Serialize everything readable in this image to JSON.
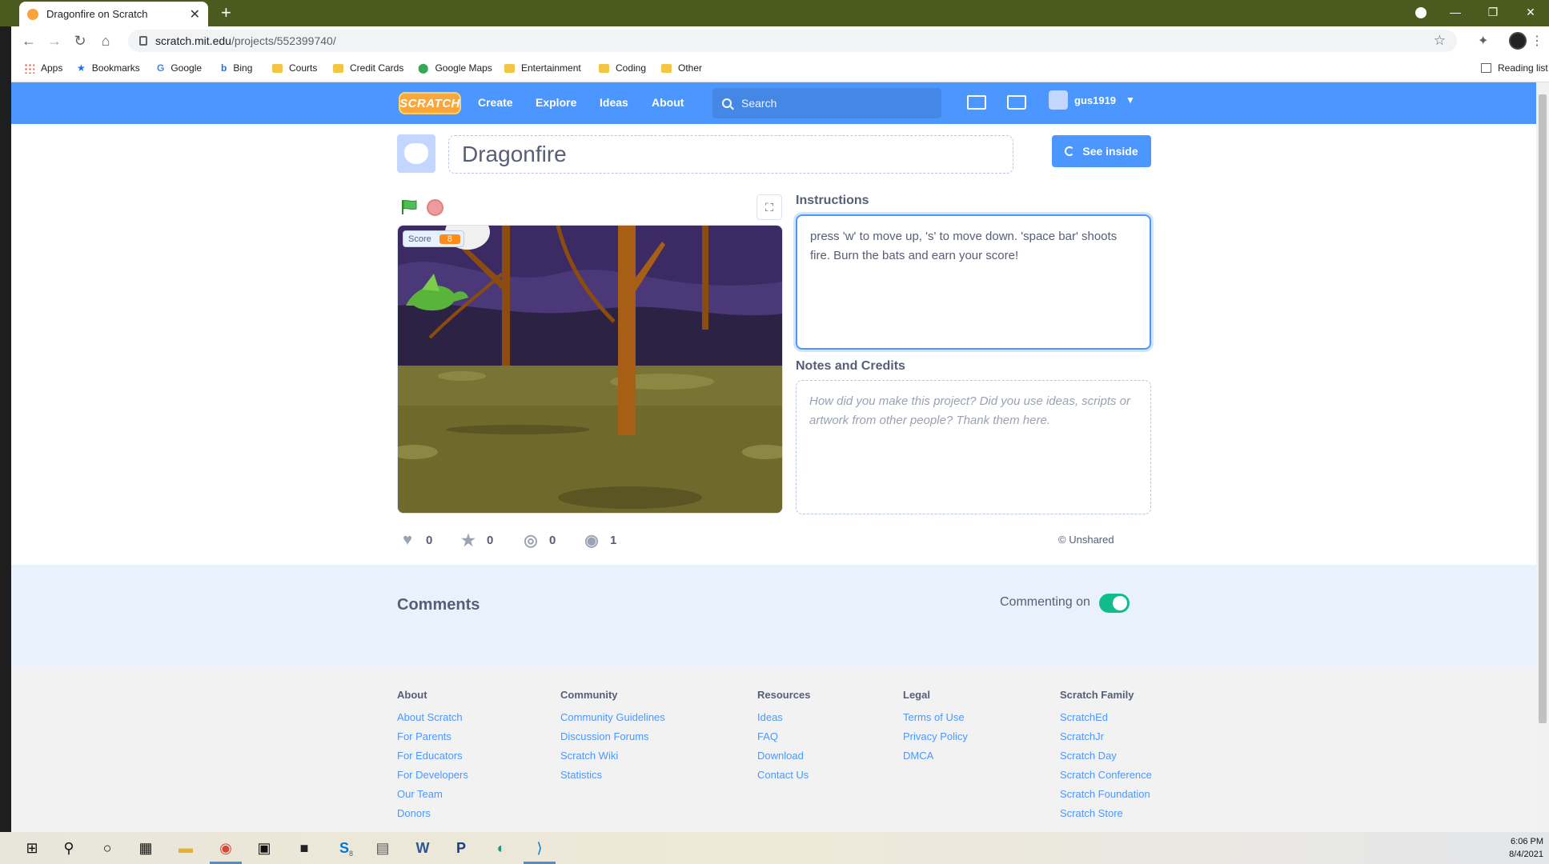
{
  "browser": {
    "tab_title": "Dragonfire on Scratch",
    "new_tab": "+",
    "url_host": "scratch.mit.edu",
    "url_path": "/projects/552399740/",
    "bookmarks": [
      "Apps",
      "Bookmarks",
      "Google",
      "Bing",
      "Courts",
      "Credit Cards",
      "Google Maps",
      "Entertainment",
      "Coding",
      "Other"
    ],
    "reading_list": "Reading list"
  },
  "nav": {
    "logo": "SCRATCH",
    "links": [
      "Create",
      "Explore",
      "Ideas",
      "About"
    ],
    "search_placeholder": "Search",
    "username": "gus1919"
  },
  "project": {
    "title": "Dragonfire",
    "see_inside": "See inside",
    "score_label": "Score",
    "score_value": "8",
    "instructions_label": "Instructions",
    "instructions_text": "press 'w' to move up, 's' to move down.  'space bar' shoots fire.  Burn the bats and earn your score!",
    "notes_label": "Notes and Credits",
    "notes_placeholder": "How did you make this project? Did you use ideas, scripts or artwork from other people? Thank them here.",
    "stats": {
      "loves": "0",
      "favorites": "0",
      "remixes": "0",
      "views": "1"
    },
    "shared_status": "Unshared"
  },
  "comments": {
    "title": "Comments",
    "commenting_label": "Commenting on",
    "commenting_enabled": true
  },
  "footer": {
    "columns": [
      {
        "title": "About",
        "links": [
          "About Scratch",
          "For Parents",
          "For Educators",
          "For Developers",
          "Our Team",
          "Donors"
        ]
      },
      {
        "title": "Community",
        "links": [
          "Community Guidelines",
          "Discussion Forums",
          "Scratch Wiki",
          "Statistics"
        ]
      },
      {
        "title": "Resources",
        "links": [
          "Ideas",
          "FAQ",
          "Download",
          "Contact Us"
        ]
      },
      {
        "title": "Legal",
        "links": [
          "Terms of Use",
          "Privacy Policy",
          "DMCA"
        ]
      },
      {
        "title": "Scratch Family",
        "links": [
          "ScratchEd",
          "ScratchJr",
          "Scratch Day",
          "Scratch Conference",
          "Scratch Foundation",
          "Scratch Store"
        ]
      }
    ]
  },
  "taskbar": {
    "time": "6:06 PM",
    "date": "8/4/2021",
    "skype_badge": "8"
  },
  "colors": {
    "scratch_blue": "#4c97ff",
    "text_gray": "#575e75",
    "toggle_green": "#0fbd8c",
    "chrome_frame": "#4b5a1e"
  }
}
